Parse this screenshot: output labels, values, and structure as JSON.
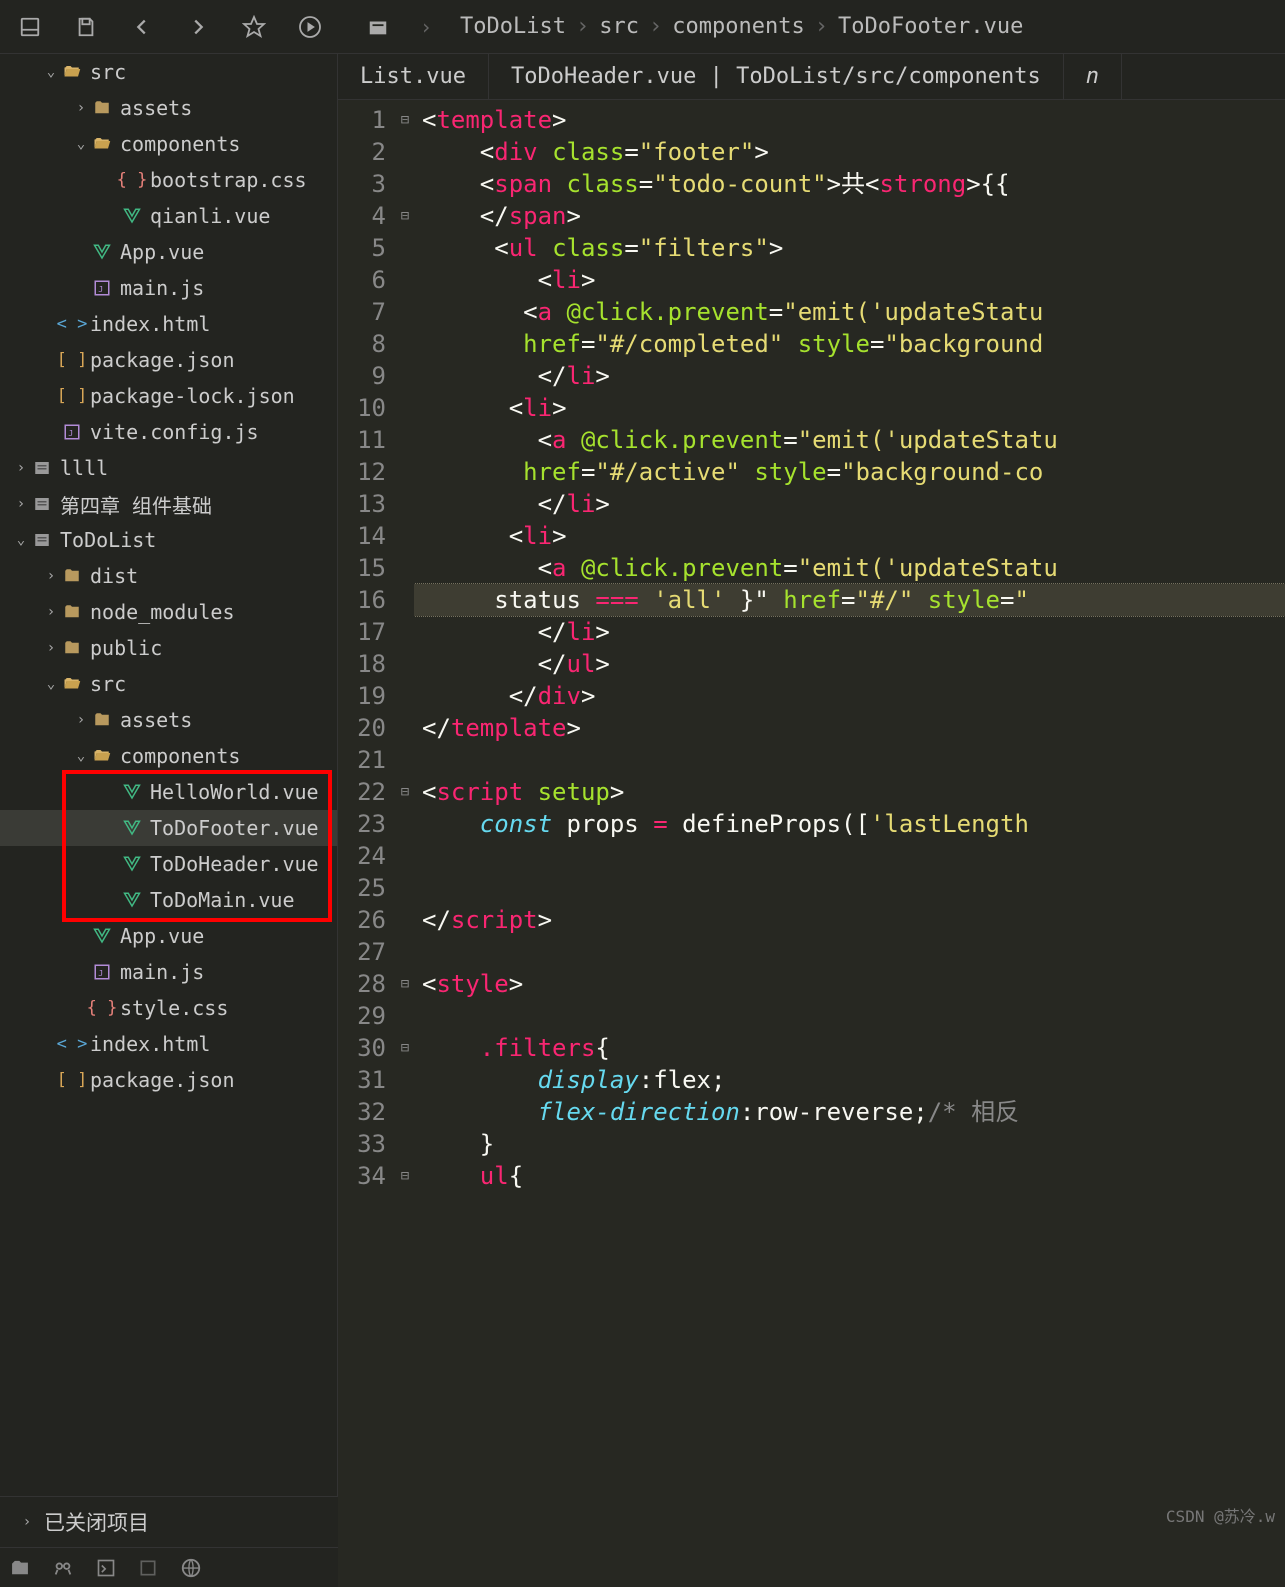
{
  "breadcrumb": [
    "ToDoList",
    "src",
    "components",
    "ToDoFooter.vue"
  ],
  "tabs": {
    "left": "List.vue",
    "mid": "ToDoHeader.vue | ToDoList/src/components",
    "right": "n"
  },
  "tree": [
    {
      "d": 1,
      "t": "folder-open",
      "exp": "down",
      "lbl": "src"
    },
    {
      "d": 2,
      "t": "folder",
      "exp": "right",
      "lbl": "assets"
    },
    {
      "d": 2,
      "t": "folder-open",
      "exp": "down",
      "lbl": "components"
    },
    {
      "d": 3,
      "t": "css",
      "lbl": "bootstrap.css"
    },
    {
      "d": 3,
      "t": "vue",
      "lbl": "qianli.vue"
    },
    {
      "d": 2,
      "t": "vue",
      "lbl": "App.vue"
    },
    {
      "d": 2,
      "t": "js",
      "lbl": "main.js"
    },
    {
      "d": 1,
      "t": "html",
      "lbl": "index.html"
    },
    {
      "d": 1,
      "t": "json",
      "lbl": "package.json"
    },
    {
      "d": 1,
      "t": "json",
      "lbl": "package-lock.json"
    },
    {
      "d": 1,
      "t": "js",
      "lbl": "vite.config.js"
    },
    {
      "d": 0,
      "t": "proj",
      "exp": "right",
      "lbl": "llll"
    },
    {
      "d": 0,
      "t": "proj",
      "exp": "right",
      "lbl": "第四章 组件基础"
    },
    {
      "d": 0,
      "t": "proj",
      "exp": "down",
      "lbl": "ToDoList"
    },
    {
      "d": 1,
      "t": "folder",
      "exp": "right",
      "lbl": "dist"
    },
    {
      "d": 1,
      "t": "folder",
      "exp": "right",
      "lbl": "node_modules"
    },
    {
      "d": 1,
      "t": "folder",
      "exp": "right",
      "lbl": "public"
    },
    {
      "d": 1,
      "t": "folder-open",
      "exp": "down",
      "lbl": "src"
    },
    {
      "d": 2,
      "t": "folder",
      "exp": "right",
      "lbl": "assets"
    },
    {
      "d": 2,
      "t": "folder-open",
      "exp": "down",
      "lbl": "components"
    },
    {
      "d": 3,
      "t": "vue",
      "lbl": "HelloWorld.vue"
    },
    {
      "d": 3,
      "t": "vue",
      "lbl": "ToDoFooter.vue",
      "sel": true
    },
    {
      "d": 3,
      "t": "vue",
      "lbl": "ToDoHeader.vue"
    },
    {
      "d": 3,
      "t": "vue",
      "lbl": "ToDoMain.vue"
    },
    {
      "d": 2,
      "t": "vue",
      "lbl": "App.vue"
    },
    {
      "d": 2,
      "t": "js",
      "lbl": "main.js"
    },
    {
      "d": 2,
      "t": "css",
      "lbl": "style.css"
    },
    {
      "d": 1,
      "t": "html",
      "lbl": "index.html"
    },
    {
      "d": 1,
      "t": "json",
      "lbl": "package.json"
    }
  ],
  "closed_projects": "已关闭项目",
  "watermark": "CSDN @苏冷.w",
  "code": {
    "lines": [
      {
        "n": 1,
        "fold": "⊟",
        "seg": [
          [
            "txt",
            "<"
          ],
          [
            "tag",
            "template"
          ],
          [
            "txt",
            ">"
          ]
        ]
      },
      {
        "n": 2,
        "seg": [
          [
            "txt",
            "    <"
          ],
          [
            "tag",
            "div"
          ],
          [
            "txt",
            " "
          ],
          [
            "attr",
            "class"
          ],
          [
            "txt",
            "="
          ],
          [
            "str",
            "\"footer\""
          ],
          [
            "txt",
            ">"
          ]
        ]
      },
      {
        "n": 3,
        "seg": [
          [
            "txt",
            "    <"
          ],
          [
            "tag",
            "span"
          ],
          [
            "txt",
            " "
          ],
          [
            "attr",
            "class"
          ],
          [
            "txt",
            "="
          ],
          [
            "str",
            "\"todo-count\""
          ],
          [
            "txt",
            ">共<"
          ],
          [
            "tag",
            "strong"
          ],
          [
            "txt",
            ">{{ "
          ]
        ]
      },
      {
        "n": 4,
        "fold": "⊟",
        "seg": [
          [
            "txt",
            "    </"
          ],
          [
            "tag",
            "span"
          ],
          [
            "txt",
            ">"
          ]
        ]
      },
      {
        "n": 5,
        "seg": [
          [
            "txt",
            "     <"
          ],
          [
            "tag",
            "ul"
          ],
          [
            "txt",
            " "
          ],
          [
            "attr",
            "class"
          ],
          [
            "txt",
            "="
          ],
          [
            "str",
            "\"filters\""
          ],
          [
            "txt",
            ">"
          ]
        ]
      },
      {
        "n": 6,
        "seg": [
          [
            "txt",
            "        <"
          ],
          [
            "tag",
            "li"
          ],
          [
            "txt",
            ">"
          ]
        ]
      },
      {
        "n": 7,
        "seg": [
          [
            "txt",
            "       <"
          ],
          [
            "tag",
            "a"
          ],
          [
            "txt",
            " "
          ],
          [
            "attr",
            "@click.prevent"
          ],
          [
            "txt",
            "="
          ],
          [
            "str",
            "\"emit('updateStatu"
          ]
        ]
      },
      {
        "n": 8,
        "seg": [
          [
            "txt",
            "       "
          ],
          [
            "attr",
            "href"
          ],
          [
            "txt",
            "="
          ],
          [
            "str",
            "\"#/completed\""
          ],
          [
            "txt",
            " "
          ],
          [
            "attr",
            "style"
          ],
          [
            "txt",
            "="
          ],
          [
            "str",
            "\"background"
          ]
        ]
      },
      {
        "n": 9,
        "seg": [
          [
            "txt",
            "        </"
          ],
          [
            "tag",
            "li"
          ],
          [
            "txt",
            ">"
          ]
        ]
      },
      {
        "n": 10,
        "seg": [
          [
            "txt",
            "      <"
          ],
          [
            "tag",
            "li"
          ],
          [
            "txt",
            ">"
          ]
        ]
      },
      {
        "n": 11,
        "seg": [
          [
            "txt",
            "        <"
          ],
          [
            "tag",
            "a"
          ],
          [
            "txt",
            " "
          ],
          [
            "attr",
            "@click.prevent"
          ],
          [
            "txt",
            "="
          ],
          [
            "str",
            "\"emit('updateStatu"
          ]
        ]
      },
      {
        "n": 12,
        "seg": [
          [
            "txt",
            "       "
          ],
          [
            "attr",
            "href"
          ],
          [
            "txt",
            "="
          ],
          [
            "str",
            "\"#/active\""
          ],
          [
            "txt",
            " "
          ],
          [
            "attr",
            "style"
          ],
          [
            "txt",
            "="
          ],
          [
            "str",
            "\"background-co"
          ]
        ]
      },
      {
        "n": 13,
        "seg": [
          [
            "txt",
            "        </"
          ],
          [
            "tag",
            "li"
          ],
          [
            "txt",
            ">"
          ]
        ]
      },
      {
        "n": 14,
        "seg": [
          [
            "txt",
            "      <"
          ],
          [
            "tag",
            "li"
          ],
          [
            "txt",
            ">"
          ]
        ]
      },
      {
        "n": 15,
        "seg": [
          [
            "txt",
            "        <"
          ],
          [
            "tag",
            "a"
          ],
          [
            "txt",
            " "
          ],
          [
            "attr",
            "@click.prevent"
          ],
          [
            "txt",
            "="
          ],
          [
            "str",
            "\"emit('updateStatu"
          ]
        ]
      },
      {
        "n": 16,
        "hl": true,
        "seg": [
          [
            "txt",
            "     status "
          ],
          [
            "op",
            "==="
          ],
          [
            "txt",
            " "
          ],
          [
            "str",
            "'all'"
          ],
          [
            "txt",
            " }\" "
          ],
          [
            "attr",
            "href"
          ],
          [
            "txt",
            "="
          ],
          [
            "str",
            "\"#/\""
          ],
          [
            "txt",
            " "
          ],
          [
            "attr",
            "style"
          ],
          [
            "txt",
            "="
          ],
          [
            "str",
            "\""
          ]
        ]
      },
      {
        "n": 17,
        "seg": [
          [
            "txt",
            "        </"
          ],
          [
            "tag",
            "li"
          ],
          [
            "txt",
            ">"
          ]
        ]
      },
      {
        "n": 18,
        "seg": [
          [
            "txt",
            "        </"
          ],
          [
            "tag",
            "ul"
          ],
          [
            "txt",
            ">"
          ]
        ]
      },
      {
        "n": 19,
        "seg": [
          [
            "txt",
            "      </"
          ],
          [
            "tag",
            "div"
          ],
          [
            "txt",
            ">"
          ]
        ]
      },
      {
        "n": 20,
        "seg": [
          [
            "txt",
            "</"
          ],
          [
            "tag",
            "template"
          ],
          [
            "txt",
            ">"
          ]
        ]
      },
      {
        "n": 21,
        "seg": []
      },
      {
        "n": 22,
        "fold": "⊟",
        "seg": [
          [
            "txt",
            "<"
          ],
          [
            "tag",
            "script"
          ],
          [
            "txt",
            " "
          ],
          [
            "attr",
            "setup"
          ],
          [
            "txt",
            ">"
          ]
        ]
      },
      {
        "n": 23,
        "seg": [
          [
            "txt",
            "    "
          ],
          [
            "kw",
            "const"
          ],
          [
            "txt",
            " props "
          ],
          [
            "op",
            "="
          ],
          [
            "txt",
            " defineProps(["
          ],
          [
            "str",
            "'lastLength"
          ]
        ]
      },
      {
        "n": 24,
        "seg": []
      },
      {
        "n": 25,
        "seg": []
      },
      {
        "n": 26,
        "seg": [
          [
            "txt",
            "</"
          ],
          [
            "tag",
            "script"
          ],
          [
            "txt",
            ">"
          ]
        ]
      },
      {
        "n": 27,
        "seg": []
      },
      {
        "n": 28,
        "fold": "⊟",
        "seg": [
          [
            "txt",
            "<"
          ],
          [
            "tag",
            "style"
          ],
          [
            "txt",
            ">"
          ]
        ]
      },
      {
        "n": 29,
        "seg": []
      },
      {
        "n": 30,
        "fold": "⊟",
        "seg": [
          [
            "txt",
            "    "
          ],
          [
            "tag",
            ".filters"
          ],
          [
            "txt",
            "{"
          ]
        ]
      },
      {
        "n": 31,
        "seg": [
          [
            "txt",
            "        "
          ],
          [
            "kw",
            "display"
          ],
          [
            "txt",
            ":flex;"
          ]
        ]
      },
      {
        "n": 32,
        "seg": [
          [
            "txt",
            "        "
          ],
          [
            "kw",
            "flex-direction"
          ],
          [
            "txt",
            ":row-reverse;"
          ],
          [
            "cmt",
            "/* 相反"
          ]
        ]
      },
      {
        "n": 33,
        "seg": [
          [
            "txt",
            "    }"
          ]
        ]
      },
      {
        "n": 34,
        "fold": "⊟",
        "seg": [
          [
            "txt",
            "    "
          ],
          [
            "tag",
            "ul"
          ],
          [
            "txt",
            "{"
          ]
        ]
      }
    ]
  }
}
